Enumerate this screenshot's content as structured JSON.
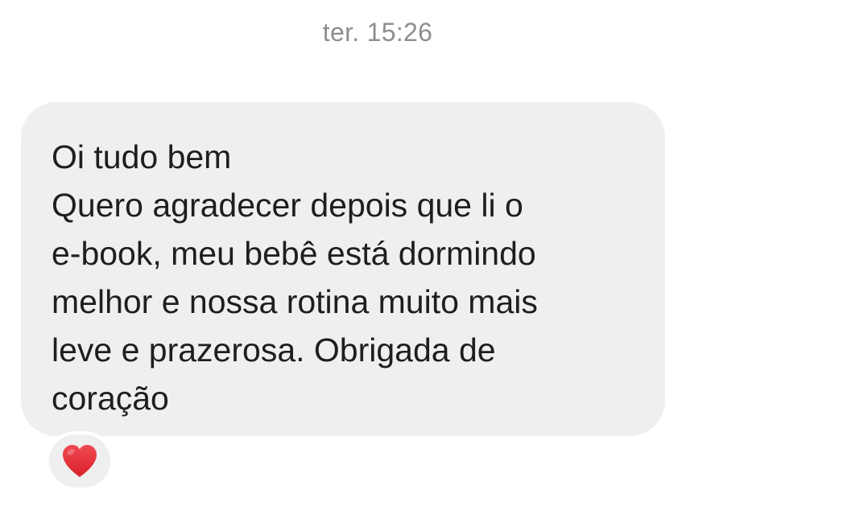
{
  "conversation": {
    "timestamp": "ter. 15:26"
  },
  "message": {
    "lines": [
      "Oi tudo bem",
      "Quero agradecer depois que li o",
      "e-book, meu bebê está dormindo",
      "melhor e nossa rotina muito mais",
      "leve e prazerosa. Obrigada de",
      "coração"
    ],
    "bubble_color": "#efefef",
    "text_color": "#1e1e1e"
  },
  "reaction": {
    "icon": "red-heart-icon",
    "color": "#e0242f"
  }
}
